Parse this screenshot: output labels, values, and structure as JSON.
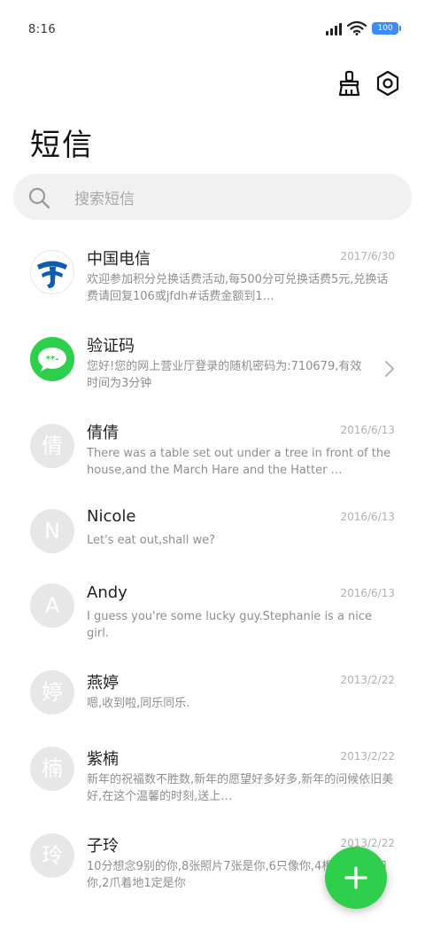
{
  "status_bar": {
    "time": "8:16",
    "battery": "100"
  },
  "header": {
    "title": "短信"
  },
  "search": {
    "placeholder": "搜索短信"
  },
  "conversations": [
    {
      "sender": "中国电信",
      "date": "2017/6/30",
      "preview": "欢迎参加积分兑换话费活动,每500分可兑换话费5元,兑换话费请回复106或jfdh#话费金额到1…",
      "avatar": "telecom-logo"
    },
    {
      "sender": "验证码",
      "date": "",
      "preview": "您好!您的网上营业厅登录的随机密码为:710679,有效时间为3分钟",
      "avatar": "message-icon"
    },
    {
      "sender": "倩倩",
      "date": "2016/6/13",
      "preview": "There was a table set out under a tree in front of the house,and the March Hare and the Hatter …",
      "avatar": "倩"
    },
    {
      "sender": "Nicole",
      "date": "2016/6/13",
      "preview": "Let's eat out,shall we?",
      "avatar": "N"
    },
    {
      "sender": "Andy",
      "date": "2016/6/13",
      "preview": "I guess you're some lucky guy.Stephanie is a nice girl.",
      "avatar": "A"
    },
    {
      "sender": "燕婷",
      "date": "2013/2/22",
      "preview": "嗯,收到啦,同乐同乐.",
      "avatar": "婷"
    },
    {
      "sender": "紫楠",
      "date": "2013/2/22",
      "preview": "新年的祝福数不胜数,新年的愿望好多好多,新年的问候依旧美好,在这个温馨的时刻,送上…",
      "avatar": "楠"
    },
    {
      "sender": "子玲",
      "date": "2013/2/22",
      "preview": "10分想念9别的你,8张照片7张是你,6只像你,4根骨头3根归你,2爪着地1定是你",
      "avatar": "玲"
    }
  ],
  "colors": {
    "accent_green": "#2fcf4e",
    "telecom_blue": "#0e5bb0"
  }
}
